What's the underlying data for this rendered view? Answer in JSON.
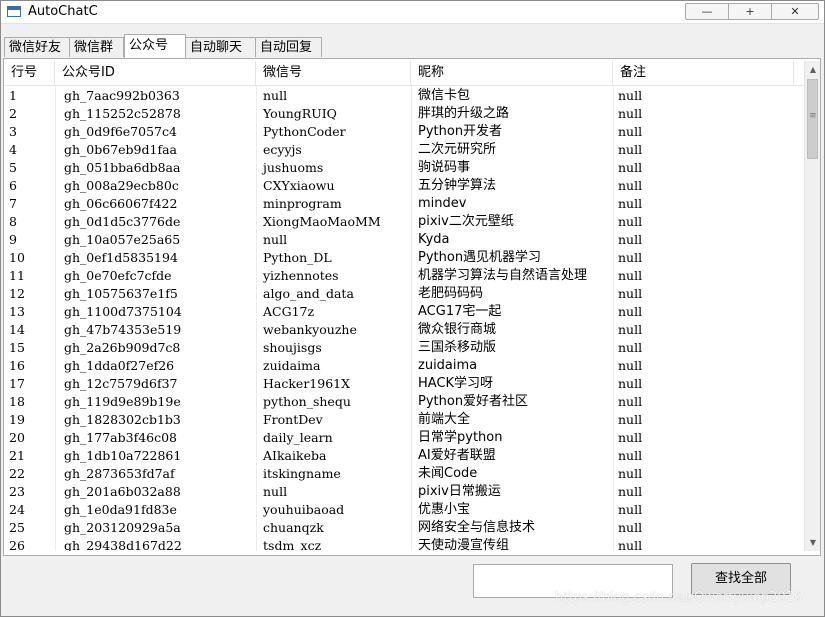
{
  "window": {
    "title": "AutoChatC",
    "minimize_glyph": "—",
    "maximize_glyph": "+",
    "close_glyph": "✕"
  },
  "tabs": [
    {
      "label": "微信好友"
    },
    {
      "label": "微信群"
    },
    {
      "label": "公众号",
      "active": true
    },
    {
      "label": "自动聊天"
    },
    {
      "label": "自动回复"
    }
  ],
  "table": {
    "columns": [
      "行号",
      "公众号ID",
      "微信号",
      "昵称",
      "备注"
    ],
    "rows": [
      [
        "1",
        "gh_7aac992b0363",
        "null",
        "微信卡包",
        "null"
      ],
      [
        "2",
        "gh_115252c52878",
        "YoungRUIQ",
        "胖琪的升级之路",
        "null"
      ],
      [
        "3",
        "gh_0d9f6e7057c4",
        "PythonCoder",
        "Python开发者",
        "null"
      ],
      [
        "4",
        "gh_0b67eb9d1faa",
        "ecyyjs",
        "二次元研究所",
        "null"
      ],
      [
        "5",
        "gh_051bba6db8aa",
        "jushuoms",
        "驹说码事",
        "null"
      ],
      [
        "6",
        "gh_008a29ecb80c",
        "CXYxiaowu",
        "五分钟学算法",
        "null"
      ],
      [
        "7",
        "gh_06c66067f422",
        "minprogram",
        "mindev",
        "null"
      ],
      [
        "8",
        "gh_0d1d5c3776de",
        "XiongMaoMaoMM",
        "pixiv二次元壁纸",
        "null"
      ],
      [
        "9",
        "gh_10a057e25a65",
        "null",
        "Kyda",
        "null"
      ],
      [
        "10",
        "gh_0ef1d5835194",
        "Python_DL",
        "Python遇见机器学习",
        "null"
      ],
      [
        "11",
        "gh_0e70efc7cfde",
        "yizhennotes",
        "机器学习算法与自然语言处理",
        "null"
      ],
      [
        "12",
        "gh_10575637e1f5",
        "algo_and_data",
        "老肥码码码",
        "null"
      ],
      [
        "13",
        "gh_1100d7375104",
        "ACG17z",
        "ACG17宅一起",
        "null"
      ],
      [
        "14",
        "gh_47b74353e519",
        "webankyouzhe",
        "微众银行商城",
        "null"
      ],
      [
        "15",
        "gh_2a26b909d7c8",
        "shoujisgs",
        "三国杀移动版",
        "null"
      ],
      [
        "16",
        "gh_1dda0f27ef26",
        "zuidaima",
        "zuidaima",
        "null"
      ],
      [
        "17",
        "gh_12c7579d6f37",
        "Hacker1961X",
        "HACK学习呀",
        "null"
      ],
      [
        "18",
        "gh_119d9e89b19e",
        "python_shequ",
        "Python爱好者社区",
        "null"
      ],
      [
        "19",
        "gh_1828302cb1b3",
        "FrontDev",
        "前端大全",
        "null"
      ],
      [
        "20",
        "gh_177ab3f46c08",
        "daily_learn",
        "日常学python",
        "null"
      ],
      [
        "21",
        "gh_1db10a722861",
        "AIkaikeba",
        "AI爱好者联盟",
        "null"
      ],
      [
        "22",
        "gh_2873653fd7af",
        "itskingname",
        "未闻Code",
        "null"
      ],
      [
        "23",
        "gh_201a6b032a88",
        "null",
        "pixiv日常搬运",
        "null"
      ],
      [
        "24",
        "gh_1e0da91fd83e",
        "youhuibaoad",
        "优惠小宝",
        "null"
      ],
      [
        "25",
        "gh_203120929a5a",
        "chuanqzk",
        "网络安全与信息技术",
        "null"
      ],
      [
        "26",
        "gh_29438d167d22",
        "tsdm_xcz",
        "天使动漫宣传组",
        "null"
      ]
    ]
  },
  "scrollbar": {
    "up_glyph": "▲",
    "down_glyph": "▼"
  },
  "search": {
    "value": ""
  },
  "find_all_label": "查找全部",
  "watermark": "https://blog.csdn.net/Qwertyuiop2016"
}
